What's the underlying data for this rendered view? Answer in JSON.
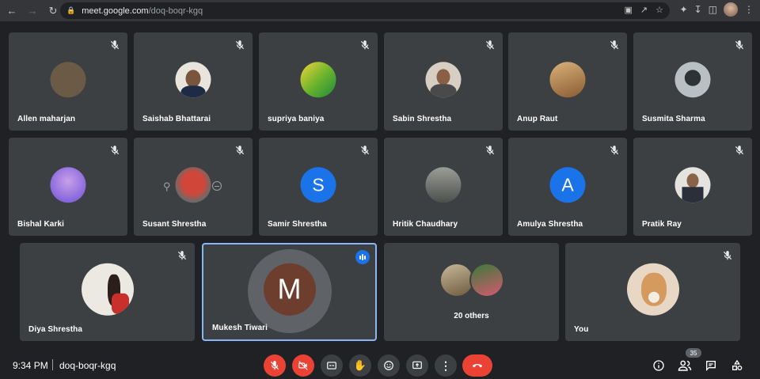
{
  "browser": {
    "url_host": "meet.google.com",
    "url_path": "/doq-boqr-kgq"
  },
  "tiles": [
    {
      "name": "Allen maharjan",
      "avatar_color": "#6b5a45"
    },
    {
      "name": "Saishab Bhattarai",
      "avatar_color": "#e9e4dc"
    },
    {
      "name": "supriya baniya",
      "avatar_color": "#6fb52c"
    },
    {
      "name": "Sabin Shrestha",
      "avatar_color": "#d8cfc4"
    },
    {
      "name": "Anup Raut",
      "avatar_color": "#b88a5c"
    },
    {
      "name": "Susmita Sharma",
      "avatar_color": "#9aa3a8"
    },
    {
      "name": "Bishal Karki",
      "avatar_color": "#8d7de0"
    },
    {
      "name": "Susant Shrestha",
      "avatar_color": "#d0473a"
    },
    {
      "name": "Samir Shrestha",
      "avatar_letter": "S",
      "avatar_color": "#1a73e8"
    },
    {
      "name": "Hritik Chaudhary",
      "avatar_color": "#6a6f6a"
    },
    {
      "name": "Amulya Shrestha",
      "avatar_letter": "A",
      "avatar_color": "#1a73e8"
    },
    {
      "name": "Pratik Ray",
      "avatar_color": "#e5e3e0"
    },
    {
      "name": "Diya Shrestha",
      "avatar_color": "#ece8e2"
    },
    {
      "name": "Mukesh Tiwari",
      "avatar_letter": "M",
      "avatar_color": "#6d3e2e"
    },
    {
      "name": "20 others"
    },
    {
      "name": "You",
      "avatar_color": "#e7d7c4"
    }
  ],
  "meeting": {
    "time": "9:34 PM",
    "code": "doq-boqr-kgq",
    "participant_count": "35"
  },
  "colors": {
    "background": "#202124",
    "tile": "#3c4043",
    "danger": "#ea4335",
    "speaking": "#8ab4f8"
  }
}
